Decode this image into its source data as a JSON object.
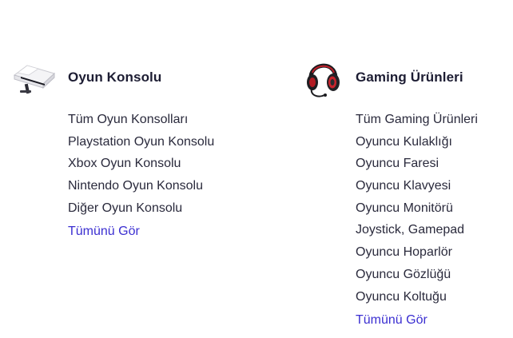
{
  "categories": [
    {
      "title": "Oyun Konsolu",
      "icon": "game-console-icon",
      "links": [
        "Tüm Oyun Konsolları",
        "Playstation Oyun Konsolu",
        "Xbox Oyun Konsolu",
        "Nintendo Oyun Konsolu",
        "Diğer Oyun Konsolu"
      ],
      "see_all": "Tümünü Gör"
    },
    {
      "title": "Gaming Ürünleri",
      "icon": "gaming-headset-icon",
      "links": [
        "Tüm Gaming Ürünleri",
        "Oyuncu Kulaklığı",
        "Oyuncu Faresi",
        "Oyuncu Klavyesi",
        "Oyuncu Monitörü",
        "Joystick, Gamepad",
        "Oyuncu Hoparlör",
        "Oyuncu Gözlüğü",
        "Oyuncu Koltuğu"
      ],
      "see_all": "Tümünü Gör"
    }
  ],
  "colors": {
    "link_text": "#2a2a3c",
    "heading_text": "#1d1d33",
    "see_all": "#3b2fd1",
    "background": "#ffffff"
  }
}
